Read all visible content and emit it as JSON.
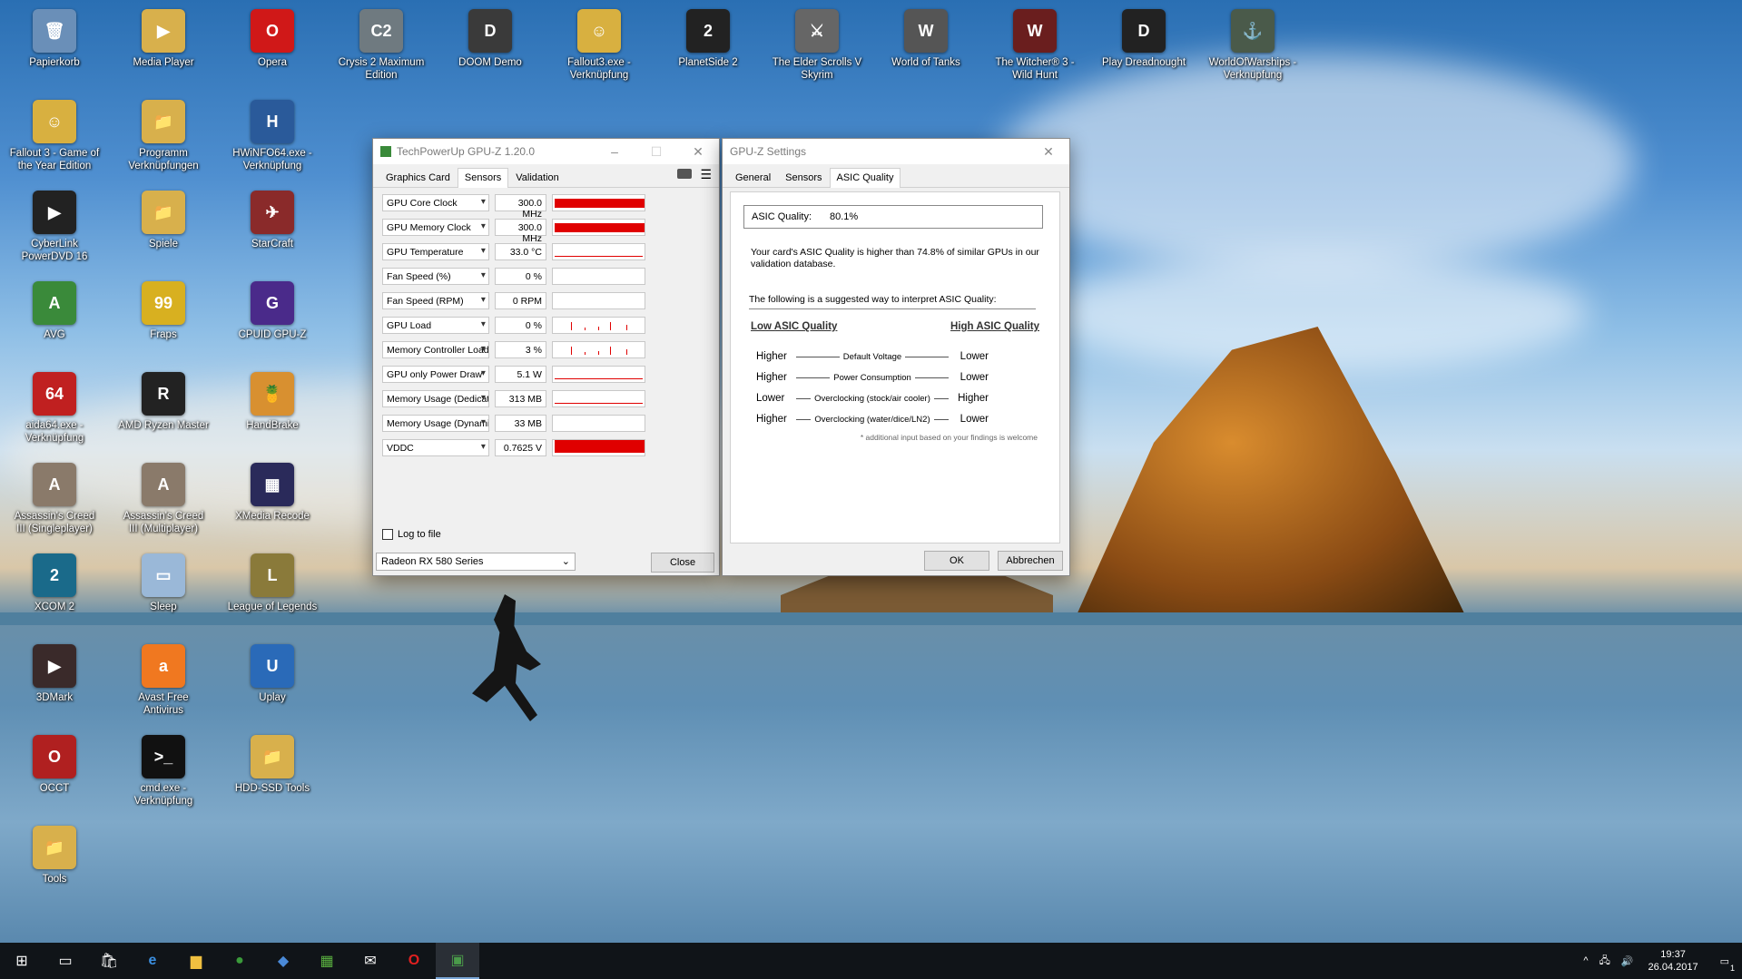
{
  "desktop": {
    "icons": [
      {
        "label": "Papierkorb",
        "color": "#6a8fb8",
        "glyph": "🗑"
      },
      {
        "label": "Media Player",
        "color": "#d8b04c",
        "glyph": "▶"
      },
      {
        "label": "Opera",
        "color": "#d01818",
        "glyph": "O"
      },
      {
        "label": "Crysis 2 Maximum Edition",
        "color": "#6f7a80",
        "glyph": "C2"
      },
      {
        "label": "DOOM Demo",
        "color": "#3a3a3a",
        "glyph": "D"
      },
      {
        "label": "Fallout3.exe - Verknüpfung",
        "color": "#d8b040",
        "glyph": "☺"
      },
      {
        "label": "PlanetSide 2",
        "color": "#222",
        "glyph": "2"
      },
      {
        "label": "The Elder Scrolls V Skyrim",
        "color": "#666",
        "glyph": "⚔"
      },
      {
        "label": "World of Tanks",
        "color": "#555",
        "glyph": "W"
      },
      {
        "label": "The Witcher® 3 - Wild Hunt",
        "color": "#6a1e1e",
        "glyph": "W"
      },
      {
        "label": "Play Dreadnought",
        "color": "#222",
        "glyph": "D"
      },
      {
        "label": "WorldOfWarships - Verknüpfung",
        "color": "#4a5a4a",
        "glyph": "⚓"
      },
      {
        "label": "Fallout 3 - Game of the Year Edition",
        "color": "#d8b040",
        "glyph": "☺"
      },
      {
        "label": "Programm Verknüpfungen",
        "color": "#d8b04c",
        "glyph": "📁"
      },
      {
        "label": "HWiNFO64.exe - Verknüpfung",
        "color": "#2a5a9a",
        "glyph": "H"
      },
      {
        "label": "CyberLink PowerDVD 16",
        "color": "#222",
        "glyph": "▶"
      },
      {
        "label": "Spiele",
        "color": "#d8b04c",
        "glyph": "📁"
      },
      {
        "label": "StarCraft",
        "color": "#8a2a2a",
        "glyph": "✈"
      },
      {
        "label": "AVG",
        "color": "#3a8a3a",
        "glyph": "A"
      },
      {
        "label": "Fraps",
        "color": "#d8b020",
        "glyph": "99"
      },
      {
        "label": "CPUID GPU-Z",
        "color": "#4a2a8a",
        "glyph": "G"
      },
      {
        "label": "aida64.exe - Verknüpfung",
        "color": "#c02020",
        "glyph": "64"
      },
      {
        "label": "AMD Ryzen Master",
        "color": "#222",
        "glyph": "R"
      },
      {
        "label": "HandBrake",
        "color": "#d89030",
        "glyph": "🍍"
      },
      {
        "label": "Assassin's Creed III (Singleplayer)",
        "color": "#8a7a6a",
        "glyph": "A"
      },
      {
        "label": "Assassin's Creed III (Multiplayer)",
        "color": "#8a7a6a",
        "glyph": "A"
      },
      {
        "label": "XMedia Recode",
        "color": "#2a2a5a",
        "glyph": "▦"
      },
      {
        "label": "XCOM 2",
        "color": "#1a6a8a",
        "glyph": "2"
      },
      {
        "label": "Sleep",
        "color": "#9ab8d8",
        "glyph": "▭"
      },
      {
        "label": "League of Legends",
        "color": "#8a7a3a",
        "glyph": "L"
      },
      {
        "label": "3DMark",
        "color": "#3a2a2a",
        "glyph": "▶"
      },
      {
        "label": "Avast Free Antivirus",
        "color": "#f07820",
        "glyph": "a"
      },
      {
        "label": "Uplay",
        "color": "#2a6ab8",
        "glyph": "U"
      },
      {
        "label": "OCCT",
        "color": "#b02020",
        "glyph": "O"
      },
      {
        "label": "cmd.exe - Verknüpfung",
        "color": "#111",
        "glyph": ">_"
      },
      {
        "label": "HDD-SSD Tools",
        "color": "#d8b04c",
        "glyph": "📁"
      },
      {
        "label": "Tools",
        "color": "#d8b04c",
        "glyph": "📁"
      }
    ]
  },
  "gpuz": {
    "title": "TechPowerUp GPU-Z 1.20.0",
    "tabs": [
      "Graphics Card",
      "Sensors",
      "Validation"
    ],
    "sensors": [
      {
        "name": "GPU Core Clock",
        "value": "300.0 MHz",
        "level": 1.0,
        "kind": "bar"
      },
      {
        "name": "GPU Memory Clock",
        "value": "300.0 MHz",
        "level": 1.0,
        "kind": "bar"
      },
      {
        "name": "GPU Temperature",
        "value": "33.0 °C",
        "level": 0.1,
        "kind": "line"
      },
      {
        "name": "Fan Speed (%)",
        "value": "0 %",
        "level": 0,
        "kind": "none"
      },
      {
        "name": "Fan Speed (RPM)",
        "value": "0 RPM",
        "level": 0,
        "kind": "none"
      },
      {
        "name": "GPU Load",
        "value": "0 %",
        "level": 0,
        "kind": "spikes"
      },
      {
        "name": "Memory Controller Load",
        "value": "3 %",
        "level": 0.03,
        "kind": "spikes"
      },
      {
        "name": "GPU only Power Draw",
        "value": "5.1 W",
        "level": 0.05,
        "kind": "line"
      },
      {
        "name": "Memory Usage (Dedicated)",
        "value": "313 MB",
        "level": 0.05,
        "kind": "line"
      },
      {
        "name": "Memory Usage (Dynamic)",
        "value": "33 MB",
        "level": 0,
        "kind": "none"
      },
      {
        "name": "VDDC",
        "value": "0.7625 V",
        "level": 1.0,
        "kind": "bigbar"
      }
    ],
    "log_to_file": "Log to file",
    "gpu_select": "Radeon RX 580 Series",
    "close": "Close"
  },
  "settings": {
    "title": "GPU-Z Settings",
    "tabs": [
      "General",
      "Sensors",
      "ASIC Quality"
    ],
    "asic_label": "ASIC Quality:",
    "asic_value": "80.1%",
    "desc": "Your card's ASIC Quality is higher than 74.8% of similar GPUs in our validation database.",
    "suggest": "The following is a suggested way to interpret ASIC Quality:",
    "low_header": "Low ASIC Quality",
    "high_header": "High ASIC Quality",
    "rows": [
      {
        "left": "Higher",
        "mid": "Default Voltage",
        "right": "Lower"
      },
      {
        "left": "Higher",
        "mid": "Power Consumption",
        "right": "Lower"
      },
      {
        "left": "Lower",
        "mid": "Overclocking (stock/air cooler)",
        "right": "Higher"
      },
      {
        "left": "Higher",
        "mid": "Overclocking (water/dice/LN2)",
        "right": "Lower"
      }
    ],
    "footnote": "* additional input based on your findings is welcome",
    "ok": "OK",
    "cancel": "Abbrechen"
  },
  "taskbar": {
    "time": "19:37",
    "date": "26.04.2017",
    "notif_count": "1"
  }
}
